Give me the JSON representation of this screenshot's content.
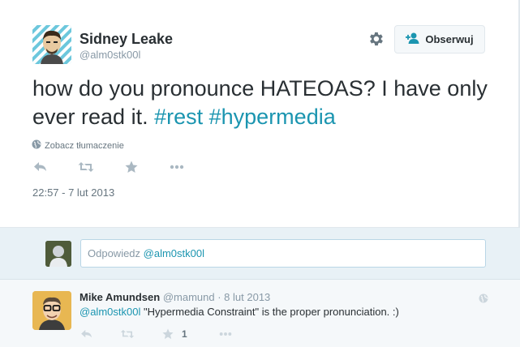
{
  "tweet": {
    "author_name": "Sidney Leake",
    "author_handle": "@alm0stk00l",
    "follow_label": "Obserwuj",
    "text_plain": "how do you pronounce HATEOAS?  I have only ever read it. ",
    "hashtag_1": "#rest",
    "hashtag_2": "#hypermedia",
    "translate_label": "Zobacz tłumaczenie",
    "timestamp": "22:57 - 7 lut 2013",
    "icons": [
      "gear-icon",
      "follow-person-icon",
      "globe-icon",
      "reply-icon",
      "retweet-icon",
      "favorite-icon",
      "more-icon"
    ]
  },
  "reply_box": {
    "prefix": "Odpowiedz ",
    "mention": "@alm0stk00l"
  },
  "reply": {
    "author_name": "Mike Amundsen",
    "author_handle": "@mamund",
    "separator": " · ",
    "date": "8 lut 2013",
    "mention": "@alm0stk00l",
    "text": " \"Hypermedia Constraint\" is the proper pronunciation. :)",
    "favorite_count": "1"
  },
  "colors": {
    "link": "#1b95b0",
    "icon": "#8899a6",
    "background": "#e1e8ed",
    "reply_bar": "#e8f1f6"
  }
}
